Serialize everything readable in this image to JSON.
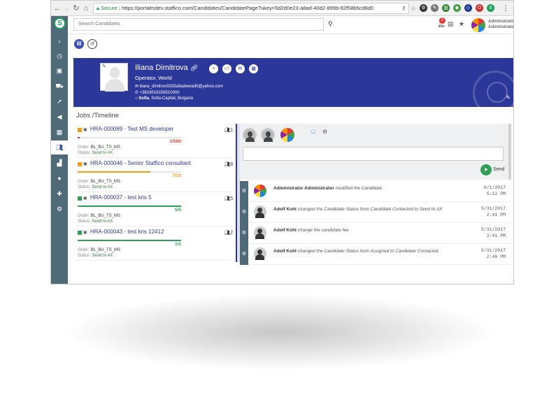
{
  "browser": {
    "secure_label": "Secure",
    "url": "https://portalrsdev.staffico.com/Candidates/CandidatePage?ukey=5d2d0e23-a8ad-40d2-899b-92f58b6cd8d0"
  },
  "topbar": {
    "search_placeholder": "Search Candidates",
    "notification_count": "2",
    "user_name": "Administrator",
    "user_role": "Administrator"
  },
  "candidate": {
    "name": "Iliana Dimitrova",
    "role": "Operator, World",
    "email": "iliana_dimitrov3333a9adwwad0@yahoo.com",
    "phone": "+3616516156510000",
    "city": "Sofia",
    "location": ", Sofia-Capital, Bulgaria"
  },
  "section_title": "Jobs /Timeline",
  "jobs": [
    {
      "id": "HRA-000069 - Test MS developer",
      "count": "1",
      "fraction": "1/500",
      "progress": 0.002,
      "order_label": "Order:",
      "order": "BL_BU_TS_MS",
      "status_label": "Status:",
      "status": "Send to AX",
      "color": "#f39c12",
      "frac_color": "#e53935",
      "bar_color": "#e53935"
    },
    {
      "id": "HRA-000046 - Senior Staffico consultant",
      "count": "8",
      "fraction": "7/10",
      "progress": 0.7,
      "order_label": "Order:",
      "order": "BL_BU_TS_MS",
      "status_label": "Status:",
      "status": "Send to AX",
      "color": "#f39c12",
      "frac_color": "#f39c12",
      "bar_color": "#f39c12"
    },
    {
      "id": "HRA-000037 - test kris 5",
      "count": "5",
      "fraction": "5/5",
      "progress": 1.0,
      "order_label": "Order:",
      "order": "BL_BU_TS_MS",
      "status_label": "Status:",
      "status": "Send to AX",
      "color": "#2e9e57",
      "frac_color": "#2e9e57",
      "bar_color": "#2e9e57"
    },
    {
      "id": "HRA-000043 - test kris 12412",
      "count": "2",
      "fraction": "1/1",
      "progress": 1.0,
      "order_label": "Order:",
      "order": "BL_BU_TS_MS",
      "status_label": "Status:",
      "status": "Send to AX",
      "color": "#2e9e57",
      "frac_color": "#2e9e57",
      "bar_color": "#2e9e57"
    }
  ],
  "timeline": {
    "send_label": "Send",
    "entries": [
      {
        "actor": "Administrator Administrator",
        "action": "modified the Candidate",
        "date": "6/1/2017",
        "time": "5:12 PM"
      },
      {
        "actor": "Adolf Kohl",
        "action": "changed the Candidate Status from Candidate Contacted to Send to AX",
        "date": "5/31/2017",
        "time": "2:41 PM"
      },
      {
        "actor": "Adolf Kohl",
        "action": "change the candidate fee",
        "date": "5/31/2017",
        "time": "2:41 PM"
      },
      {
        "actor": "Adolf Kohl",
        "action": "changed the Candidate Status from Assigned to Candidate Contacted",
        "date": "5/31/2017",
        "time": "2:40 PM"
      }
    ]
  }
}
